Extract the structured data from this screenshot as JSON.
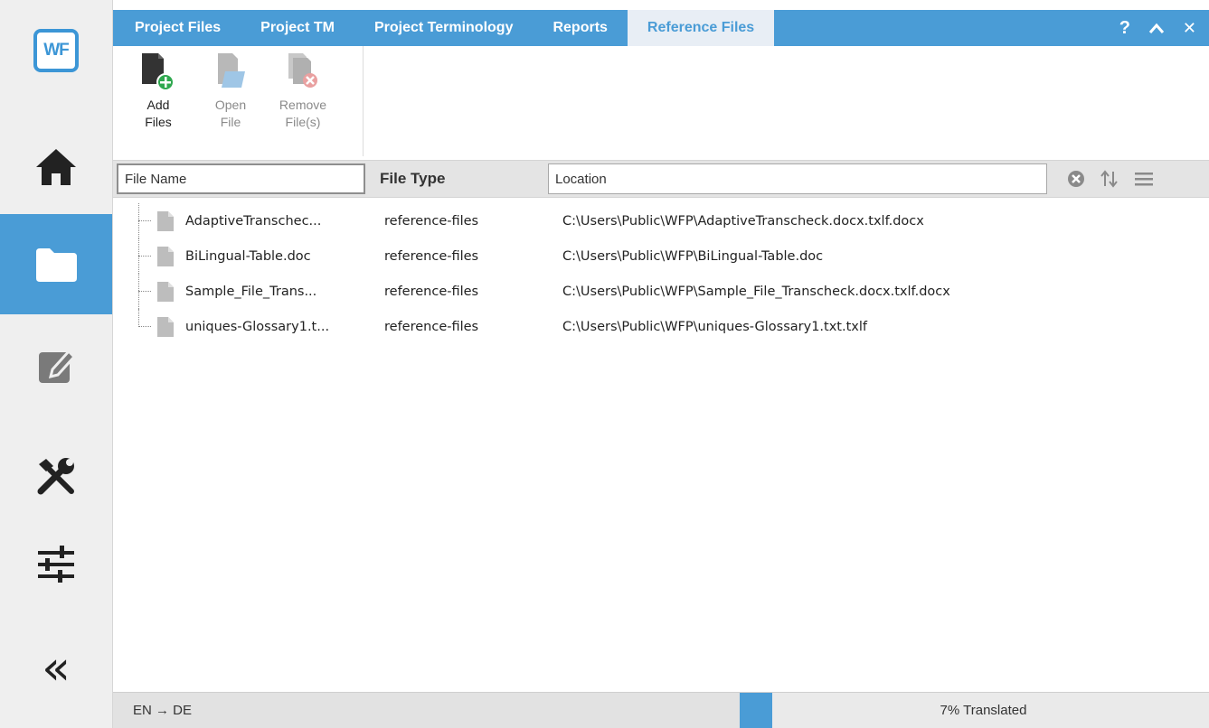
{
  "sidebar": {
    "logo_text": "WF",
    "items": [
      {
        "name": "home-icon",
        "active": false
      },
      {
        "name": "folder-icon",
        "active": true
      },
      {
        "name": "edit-icon",
        "active": false
      },
      {
        "name": "tools-icon",
        "active": false
      },
      {
        "name": "sliders-icon",
        "active": false
      },
      {
        "name": "collapse-icon",
        "active": false
      }
    ],
    "collapse_glyph": "«"
  },
  "tabs": [
    {
      "label": "Project Files",
      "active": false
    },
    {
      "label": "Project TM",
      "active": false
    },
    {
      "label": "Project Terminology",
      "active": false
    },
    {
      "label": "Reports",
      "active": false
    },
    {
      "label": "Reference Files",
      "active": true
    }
  ],
  "window_controls": {
    "help": "?",
    "minimize": "^",
    "close": "✕"
  },
  "ribbon": {
    "add_files": {
      "line1": "Add",
      "line2": "Files"
    },
    "open_file": {
      "line1": "Open",
      "line2": "File"
    },
    "remove_files": {
      "line1": "Remove",
      "line2": "File(s)"
    }
  },
  "columns": {
    "file_name_placeholder": "File Name",
    "file_type": "File Type",
    "location_placeholder": "Location"
  },
  "files": [
    {
      "name": "AdaptiveTranschec...",
      "type": "reference-files",
      "location": "C:\\Users\\Public\\WFP\\AdaptiveTranscheck.docx.txlf.docx"
    },
    {
      "name": "BiLingual-Table.doc",
      "type": "reference-files",
      "location": "C:\\Users\\Public\\WFP\\BiLingual-Table.doc"
    },
    {
      "name": "Sample_File_Trans...",
      "type": "reference-files",
      "location": "C:\\Users\\Public\\WFP\\Sample_File_Transcheck.docx.txlf.docx"
    },
    {
      "name": "uniques-Glossary1.t...",
      "type": "reference-files",
      "location": "C:\\Users\\Public\\WFP\\uniques-Glossary1.txt.txlf"
    }
  ],
  "status": {
    "language_pair": "EN → DE",
    "translated_text": "7% Translated",
    "translated_fraction": 0.07
  },
  "colors": {
    "accent": "#4a9cd6",
    "add_green": "#2fa84f",
    "remove_red": "#d9534f"
  }
}
